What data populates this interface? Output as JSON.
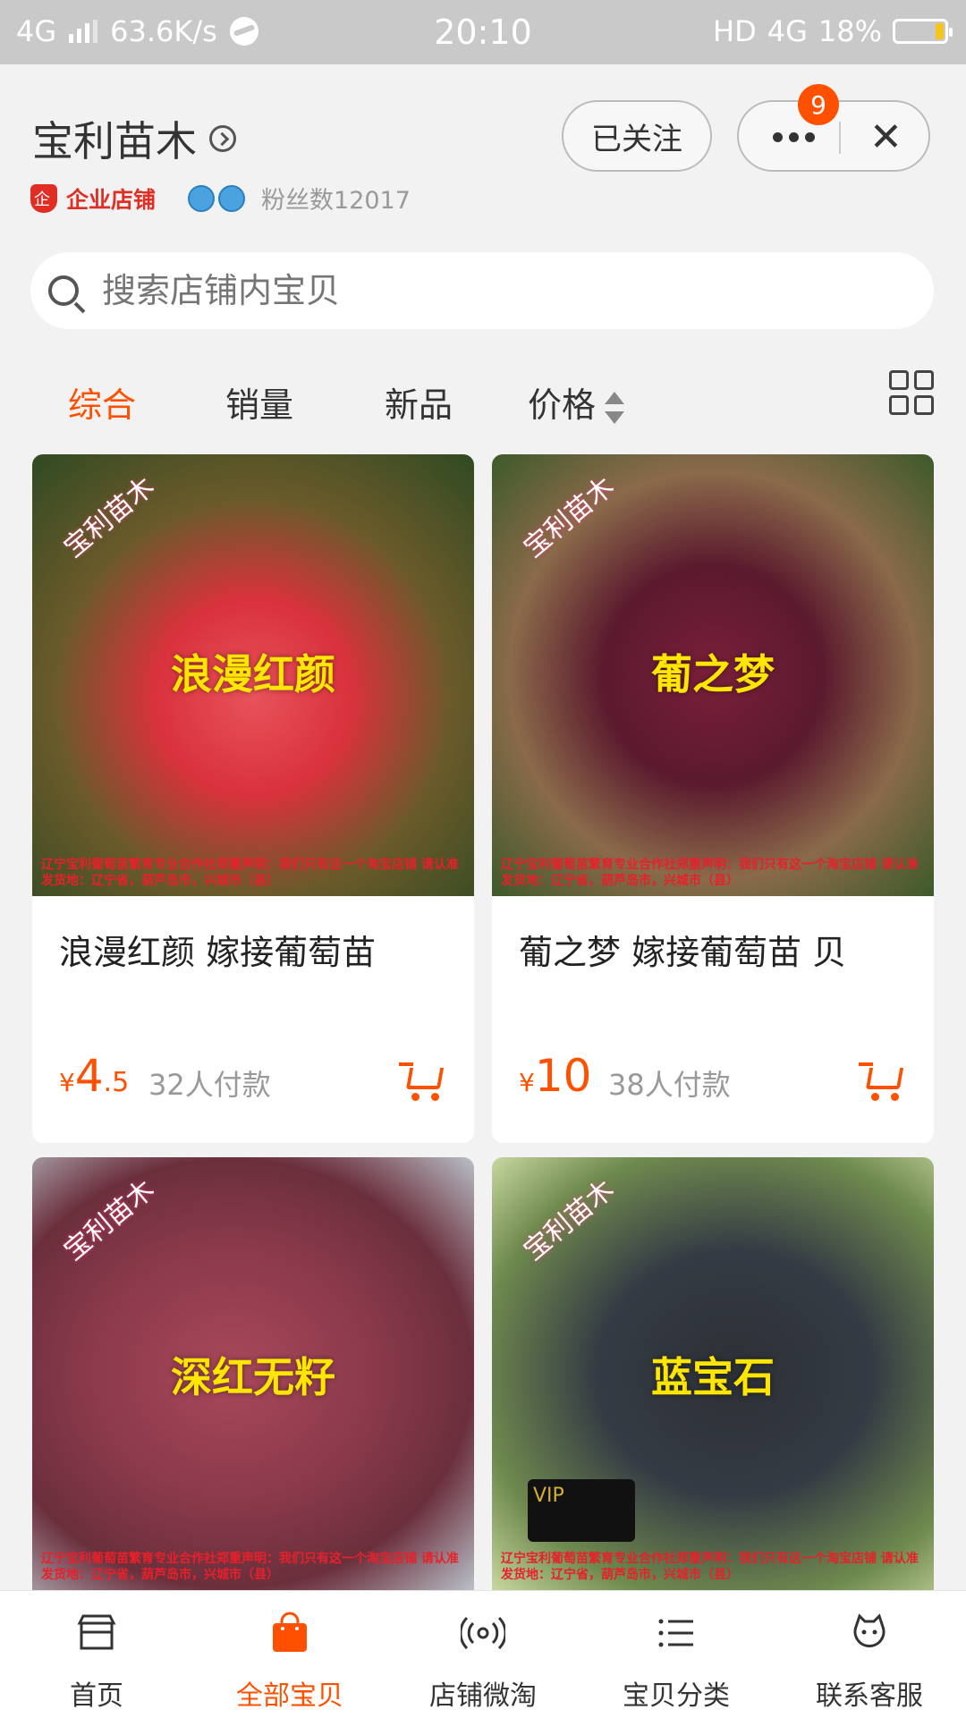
{
  "status_bar": {
    "network": "4G",
    "speed": "63.6K/s",
    "time": "20:10",
    "hd": "HD",
    "net2": "4G",
    "battery": "18%"
  },
  "shop": {
    "name": "宝利苗木",
    "follow_label": "已关注",
    "more_badge": "9",
    "close_label": "✕",
    "enterprise_label": "企业店铺",
    "fans": "粉丝数12017"
  },
  "search": {
    "placeholder": "搜索店铺内宝贝"
  },
  "sort_tabs": [
    {
      "label": "综合",
      "active": true
    },
    {
      "label": "销量"
    },
    {
      "label": "新品"
    },
    {
      "label": "价格"
    }
  ],
  "products": [
    {
      "overlay": "浪漫红颜",
      "watermark": "宝利苗木",
      "fine_print": "辽宁宝利葡萄苗繁育专业合作社郑重声明：我们只有这一个淘宝店铺 请认准发货地：辽宁省，葫芦岛市，兴城市（县）",
      "title": "浪漫红颜  嫁接葡萄苗",
      "currency": "¥",
      "price_int": "4",
      "price_dec": ".5",
      "sold": "32人付款"
    },
    {
      "overlay": "葡之梦",
      "watermark": "宝利苗木",
      "fine_print": "辽宁宝利葡萄苗繁育专业合作社郑重声明：我们只有这一个淘宝店铺 请认准发货地：辽宁省，葫芦岛市，兴城市（县）",
      "title": "葡之梦  嫁接葡萄苗 贝",
      "currency": "¥",
      "price_int": "10",
      "price_dec": "",
      "sold": "38人付款"
    },
    {
      "overlay": "深红无籽",
      "watermark": "宝利苗木",
      "fine_print": "辽宁宝利葡萄苗繁育专业合作社郑重声明：我们只有这一个淘宝店铺 请认准发货地：辽宁省，葫芦岛市，兴城市（县）"
    },
    {
      "overlay": "蓝宝石",
      "watermark": "宝利苗木",
      "fine_print": "辽宁宝利葡萄苗繁育专业合作社郑重声明：我们只有这一个淘宝店铺 请认准发货地：辽宁省，葫芦岛市，兴城市（县）",
      "vip_label": "VIP"
    }
  ],
  "bottom_nav": [
    {
      "label": "首页",
      "icon": "shop-icon"
    },
    {
      "label": "全部宝贝",
      "icon": "bag-icon",
      "active": true
    },
    {
      "label": "店铺微淘",
      "icon": "broadcast-icon"
    },
    {
      "label": "宝贝分类",
      "icon": "list-icon"
    },
    {
      "label": "联系客服",
      "icon": "service-icon"
    }
  ],
  "colors": {
    "accent": "#ff5000",
    "enterprise": "#e02e24"
  }
}
